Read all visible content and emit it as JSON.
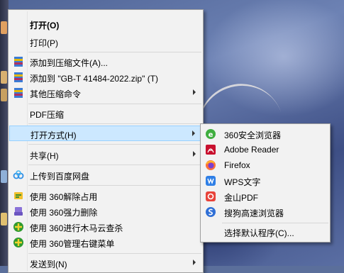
{
  "main_menu": {
    "items": [
      {
        "label": "打开(O)",
        "icon": "none"
      },
      {
        "label": "打印(P)",
        "icon": "none"
      },
      {
        "label": "添加到压缩文件(A)...",
        "icon": "winrar-archive-icon"
      },
      {
        "label": "添加到 \"GB-T 41484-2022.zip\" (T)",
        "icon": "winrar-archive-icon"
      },
      {
        "label": "其他压缩命令",
        "icon": "winrar-archive-icon"
      },
      {
        "label": "PDF压缩",
        "icon": "none"
      },
      {
        "label": "打开方式(H)",
        "icon": "none"
      },
      {
        "label": "共享(H)",
        "icon": "none"
      },
      {
        "label": "上传到百度网盘",
        "icon": "baidu-netdisk-icon"
      },
      {
        "label": "使用 360解除占用",
        "icon": "360-unlock-icon"
      },
      {
        "label": "使用 360强力删除",
        "icon": "360-shred-icon"
      },
      {
        "label": "使用 360进行木马云查杀",
        "icon": "360-trojan-scan-icon"
      },
      {
        "label": "使用 360管理右键菜单",
        "icon": "360-menu-manager-icon"
      },
      {
        "label": "发送到(N)",
        "icon": "none"
      }
    ]
  },
  "open_with_menu": {
    "items": [
      {
        "label": "360安全浏览器",
        "icon": "360-browser-icon"
      },
      {
        "label": "Adobe Reader",
        "icon": "adobe-reader-icon"
      },
      {
        "label": "Firefox",
        "icon": "firefox-icon"
      },
      {
        "label": "WPS文字",
        "icon": "wps-writer-icon"
      },
      {
        "label": "金山PDF",
        "icon": "kingsoft-pdf-icon"
      },
      {
        "label": "搜狗高速浏览器",
        "icon": "sogou-browser-icon"
      },
      {
        "label": "选择默认程序(C)...",
        "icon": "none"
      }
    ]
  },
  "colors": {
    "menu_bg": "#f2f2f2",
    "highlight_bg": "#cce8ff",
    "highlight_border": "#99d1ff"
  }
}
